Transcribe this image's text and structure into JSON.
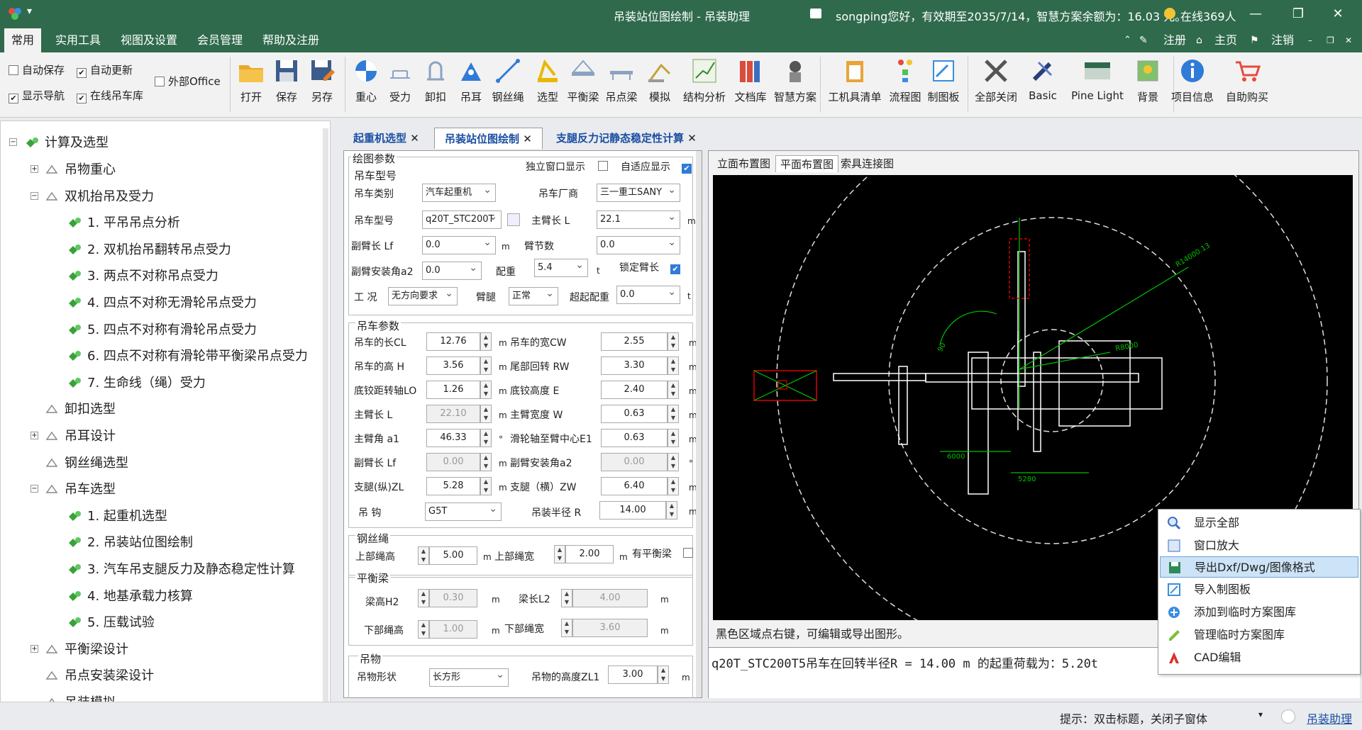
{
  "title": {
    "app": "吊装站位图绘制 - 吊装助理",
    "user_info": "songping您好，有效期至2035/7/14，智慧方案余额为：16.03 元。",
    "online": "在线369人"
  },
  "menu": {
    "items": [
      "常用",
      "实用工具",
      "视图及设置",
      "会员管理",
      "帮助及注册"
    ],
    "right": [
      "注册",
      "主页",
      "注销"
    ]
  },
  "ribbon": {
    "checks": [
      {
        "label": "自动保存",
        "checked": false
      },
      {
        "label": "自动更新",
        "checked": true
      },
      {
        "label": "外部Office",
        "checked": false
      },
      {
        "label": "显示导航",
        "checked": true
      },
      {
        "label": "在线吊车库",
        "checked": true
      }
    ],
    "buttons": [
      "打开",
      "保存",
      "另存",
      "重心",
      "受力",
      "卸扣",
      "吊耳",
      "钢丝绳",
      "选型",
      "平衡梁",
      "吊点梁",
      "模拟",
      "结构分析",
      "文档库",
      "智慧方案",
      "工机具清单",
      "流程图",
      "制图板",
      "全部关闭",
      "Basic",
      "Pine Light",
      "背景",
      "项目信息",
      "自助购买"
    ]
  },
  "tree": {
    "root": "计算及选型",
    "items": [
      "吊物重心",
      "双机抬吊及受力",
      "1. 平吊吊点分析",
      "2. 双机抬吊翻转吊点受力",
      "3. 两点不对称吊点受力",
      "4. 四点不对称无滑轮吊点受力",
      "5. 四点不对称有滑轮吊点受力",
      "6. 四点不对称有滑轮带平衡梁吊点受力",
      "7. 生命线（绳）受力",
      "卸扣选型",
      "吊耳设计",
      "钢丝绳选型",
      "吊车选型",
      "1. 起重机选型",
      "2. 吊装站位图绘制",
      "3. 汽车吊支腿反力及静态稳定性计算",
      "4. 地基承载力核算",
      "5. 压载试验",
      "平衡梁设计",
      "吊点安装梁设计",
      "吊装模拟"
    ]
  },
  "tabs": [
    "起重机选型",
    "吊装站位图绘制",
    "支腿反力记静态稳定性计算"
  ],
  "params": {
    "section_draw": "绘图参数",
    "independent_window": "独立窗口显示",
    "adaptive": "自适应显示",
    "section_model": "吊车型号",
    "crane_type_label": "吊车类别",
    "crane_type": "汽车起重机",
    "maker_label": "吊车厂商",
    "maker": "三一重工SANY",
    "model_label": "吊车型号",
    "model": "q20T_STC200T",
    "boom_label": "主臂长 L",
    "boom": "22.1",
    "boom_unit": "m",
    "jib_label": "副臂长 Lf",
    "jib": "0.0",
    "jib_unit": "m",
    "sections_label": "臂节数",
    "sections": "0.0",
    "jib_angle_label": "副臂安装角a2",
    "jib_angle": "0.0",
    "cw_label": "配重",
    "cw": "5.4",
    "cw_unit": "t",
    "lock_label": "锁定臂长",
    "cond_label": "工 况",
    "cond": "无方向要求",
    "arm_label": "臂腿",
    "arm": "正常",
    "extra_cw_label": "超起配重",
    "extra_cw": "0.0",
    "extra_cw_unit": "t",
    "section_crane": "吊车参数",
    "grid": [
      {
        "label": "吊车的长CL",
        "value": "12.76",
        "unit": "m",
        "label2": "吊车的宽CW",
        "value2": "2.55",
        "unit2": "m"
      },
      {
        "label": "吊车的高 H",
        "value": "3.56",
        "unit": "m",
        "label2": "尾部回转 RW",
        "value2": "3.30",
        "unit2": "m"
      },
      {
        "label": "底铰距转轴LO",
        "value": "1.26",
        "unit": "m",
        "label2": "底铰高度 E",
        "value2": "2.40",
        "unit2": "m"
      },
      {
        "label": "主臂长 L",
        "value": "22.10",
        "unit": "m",
        "label2": "主臂宽度 W",
        "value2": "0.63",
        "unit2": "m"
      },
      {
        "label": "主臂角 a1",
        "value": "46.33",
        "unit": "°",
        "label2": "滑轮轴至臂中心E1",
        "value2": "0.63",
        "unit2": "m"
      },
      {
        "label": "副臂长 Lf",
        "value": "0.00",
        "unit": "m",
        "label2": "副臂安装角a2",
        "value2": "0.00",
        "unit2": "°"
      },
      {
        "label": "支腿(纵)ZL",
        "value": "5.28",
        "unit": "m",
        "label2": "支腿（横）ZW",
        "value2": "6.40",
        "unit2": "m"
      }
    ],
    "hook_label": "吊 钩",
    "hook": "G5T",
    "radius_label": "吊装半径 R",
    "radius": "14.00",
    "radius_unit": "m",
    "section_rope": "钢丝绳",
    "upper_h_label": "上部绳高",
    "upper_h": "5.00",
    "upper_w_label": "上部绳宽",
    "upper_w": "2.00",
    "m": "m",
    "has_beam_label": "有平衡梁",
    "section_beam": "平衡梁",
    "beam_h_label": "梁高H2",
    "beam_h": "0.30",
    "beam_l_label": "梁长L2",
    "beam_l": "4.00",
    "lower_h_label": "下部绳高",
    "lower_h": "1.00",
    "lower_w_label": "下部绳宽",
    "lower_w": "3.60",
    "section_load": "吊物",
    "shape_label": "吊物形状",
    "shape": "长方形",
    "height_label": "吊物的高度ZL1",
    "height": "3.00"
  },
  "drawing": {
    "tabs": [
      "立面布置图",
      "平面布置图",
      "索具连接图"
    ],
    "dims": {
      "r_big": "R14000.13",
      "r_mid": "R8000",
      "d1": "6000",
      "d2": "5280",
      "angle": "90"
    },
    "hint": "黑色区域点右键，可编辑或导出图形。",
    "result": "q20T_STC200T5吊车在回转半径R = 14.00 m 的起重荷载为：5.20t"
  },
  "context_menu": [
    "显示全部",
    "窗口放大",
    "导出Dxf/Dwg/图像格式",
    "导入制图板",
    "添加到临时方案图库",
    "管理临时方案图库",
    "CAD编辑"
  ],
  "status": {
    "tip": "提示：双击标题，关闭子窗体",
    "link": "吊装助理"
  }
}
